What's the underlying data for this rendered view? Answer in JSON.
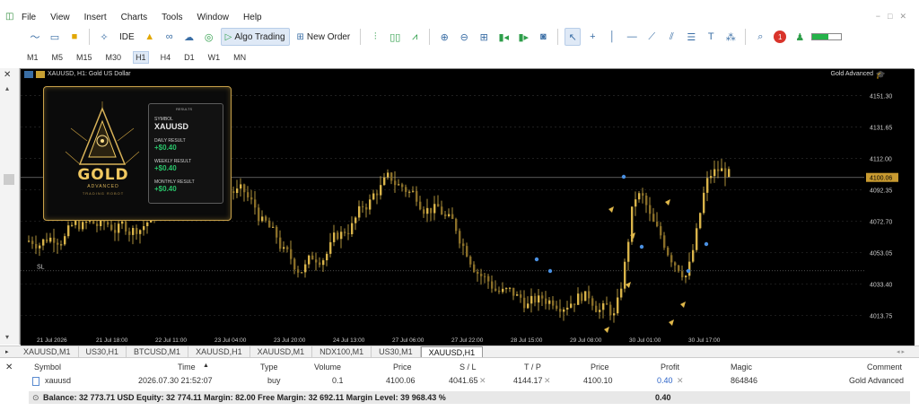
{
  "menu": {
    "app_icon": "terminal-app-icon",
    "items": [
      "File",
      "View",
      "Insert",
      "Charts",
      "Tools",
      "Window",
      "Help"
    ],
    "window_controls": [
      "−",
      "□",
      "✕"
    ]
  },
  "toolbar": {
    "algo_trading_label": "Algo Trading",
    "new_order_label": "New Order",
    "ide_label": "IDE",
    "notification_count": "1",
    "signal_strength": 0.55
  },
  "timeframes": {
    "items": [
      "M1",
      "M5",
      "M15",
      "M30",
      "H1",
      "H4",
      "D1",
      "W1",
      "MN"
    ],
    "active": "H1"
  },
  "chart": {
    "title": "XAUUSD, H1: Gold US Dollar",
    "ea_name": "Gold Advanced",
    "sl_marker": "SL",
    "current_price": "4100.06",
    "price_labels": [
      "4151.30",
      "4131.65",
      "4112.00",
      "4100.06",
      "4092.35",
      "4072.70",
      "4053.05",
      "4033.40",
      "4013.75"
    ],
    "time_labels": [
      "21 Jul 2026",
      "21 Jul 18:00",
      "22 Jul 11:00",
      "23 Jul 04:00",
      "23 Jul 20:00",
      "24 Jul 13:00",
      "27 Jul 06:00",
      "27 Jul 22:00",
      "28 Jul 15:00",
      "29 Jul 08:00",
      "30 Jul 01:00",
      "30 Jul 17:00"
    ],
    "colors": {
      "background": "#000000",
      "candle": "#d9b44a",
      "grid": "#2a2a2a",
      "price_tag": "#c89a30"
    }
  },
  "panel": {
    "logo_text": "GOLD",
    "logo_sub": "ADVANCED",
    "logo_sub2": "TRADING ROBOT",
    "card_head": "RESULTS",
    "symbol_label": "SYMBOL",
    "symbol_value": "XAUUSD",
    "daily_label": "DAILY RESULT",
    "daily_value": "+$0.40",
    "weekly_label": "WEEKLY RESULT",
    "weekly_value": "+$0.40",
    "monthly_label": "MONTHLY RESULT",
    "monthly_value": "+$0.40"
  },
  "chart_tabs": {
    "items": [
      "XAUUSD,M1",
      "US30,H1",
      "BTCUSD,M1",
      "XAUUSD,H1",
      "XAUUSD,M1",
      "NDX100,M1",
      "US30,M1",
      "XAUUSD,H1"
    ],
    "active_index": 7
  },
  "trade_table": {
    "headers": {
      "symbol": "Symbol",
      "time": "Time",
      "sort_arrow": "▲",
      "type": "Type",
      "volume": "Volume",
      "price": "Price",
      "sl": "S / L",
      "tp": "T / P",
      "price2": "Price",
      "profit": "Profit",
      "magic": "Magic",
      "comment": "Comment"
    },
    "row": {
      "symbol": "xauusd",
      "time": "2026.07.30 21:52:07",
      "type": "buy",
      "volume": "0.1",
      "price": "4100.06",
      "sl": "4041.65",
      "tp": "4144.17",
      "price2": "4100.10",
      "profit": "0.40",
      "magic": "864846",
      "comment": "Gold Advanced"
    },
    "balance_line": "Balance: 32 773.71 USD  Equity: 32 774.11  Margin: 82.00  Free Margin: 32 692.11  Margin Level: 39 968.43 %",
    "balance_profit": "0.40"
  }
}
